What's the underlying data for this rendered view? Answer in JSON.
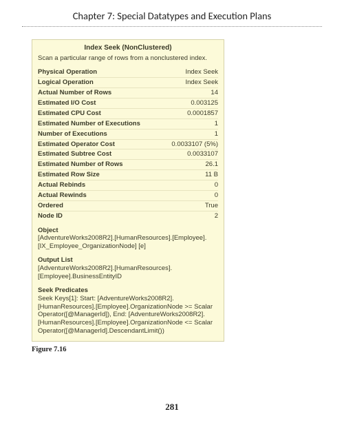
{
  "header": {
    "chapter_title": "Chapter 7: Special Datatypes and Execution Plans"
  },
  "tooltip": {
    "title": "Index Seek (NonClustered)",
    "description": "Scan a particular range of rows from a nonclustered index.",
    "rows": [
      {
        "label": "Physical Operation",
        "value": "Index Seek"
      },
      {
        "label": "Logical Operation",
        "value": "Index Seek"
      },
      {
        "label": "Actual Number of Rows",
        "value": "14"
      },
      {
        "label": "Estimated I/O Cost",
        "value": "0.003125"
      },
      {
        "label": "Estimated CPU Cost",
        "value": "0.0001857"
      },
      {
        "label": "Estimated Number of Executions",
        "value": "1"
      },
      {
        "label": "Number of Executions",
        "value": "1"
      },
      {
        "label": "Estimated Operator Cost",
        "value": "0.0033107 (5%)"
      },
      {
        "label": "Estimated Subtree Cost",
        "value": "0.0033107"
      },
      {
        "label": "Estimated Number of Rows",
        "value": "26.1"
      },
      {
        "label": "Estimated Row Size",
        "value": "11 B"
      },
      {
        "label": "Actual Rebinds",
        "value": "0"
      },
      {
        "label": "Actual Rewinds",
        "value": "0"
      },
      {
        "label": "Ordered",
        "value": "True"
      },
      {
        "label": "Node ID",
        "value": "2"
      }
    ],
    "sections": [
      {
        "heading": "Object",
        "body": "[AdventureWorks2008R2].[HumanResources].[Employee].[IX_Employee_OrganizationNode] [e]"
      },
      {
        "heading": "Output List",
        "body": "[AdventureWorks2008R2].[HumanResources].[Employee].BusinessEntityID"
      },
      {
        "heading": "Seek Predicates",
        "body": "Seek Keys[1]: Start: [AdventureWorks2008R2].[HumanResources].[Employee].OrganizationNode >= Scalar Operator([@ManagerId]), End: [AdventureWorks2008R2].[HumanResources].[Employee].OrganizationNode <= Scalar Operator([@ManagerId].DescendantLimit())"
      }
    ]
  },
  "caption": "Figure 7.16",
  "page_number": "281"
}
